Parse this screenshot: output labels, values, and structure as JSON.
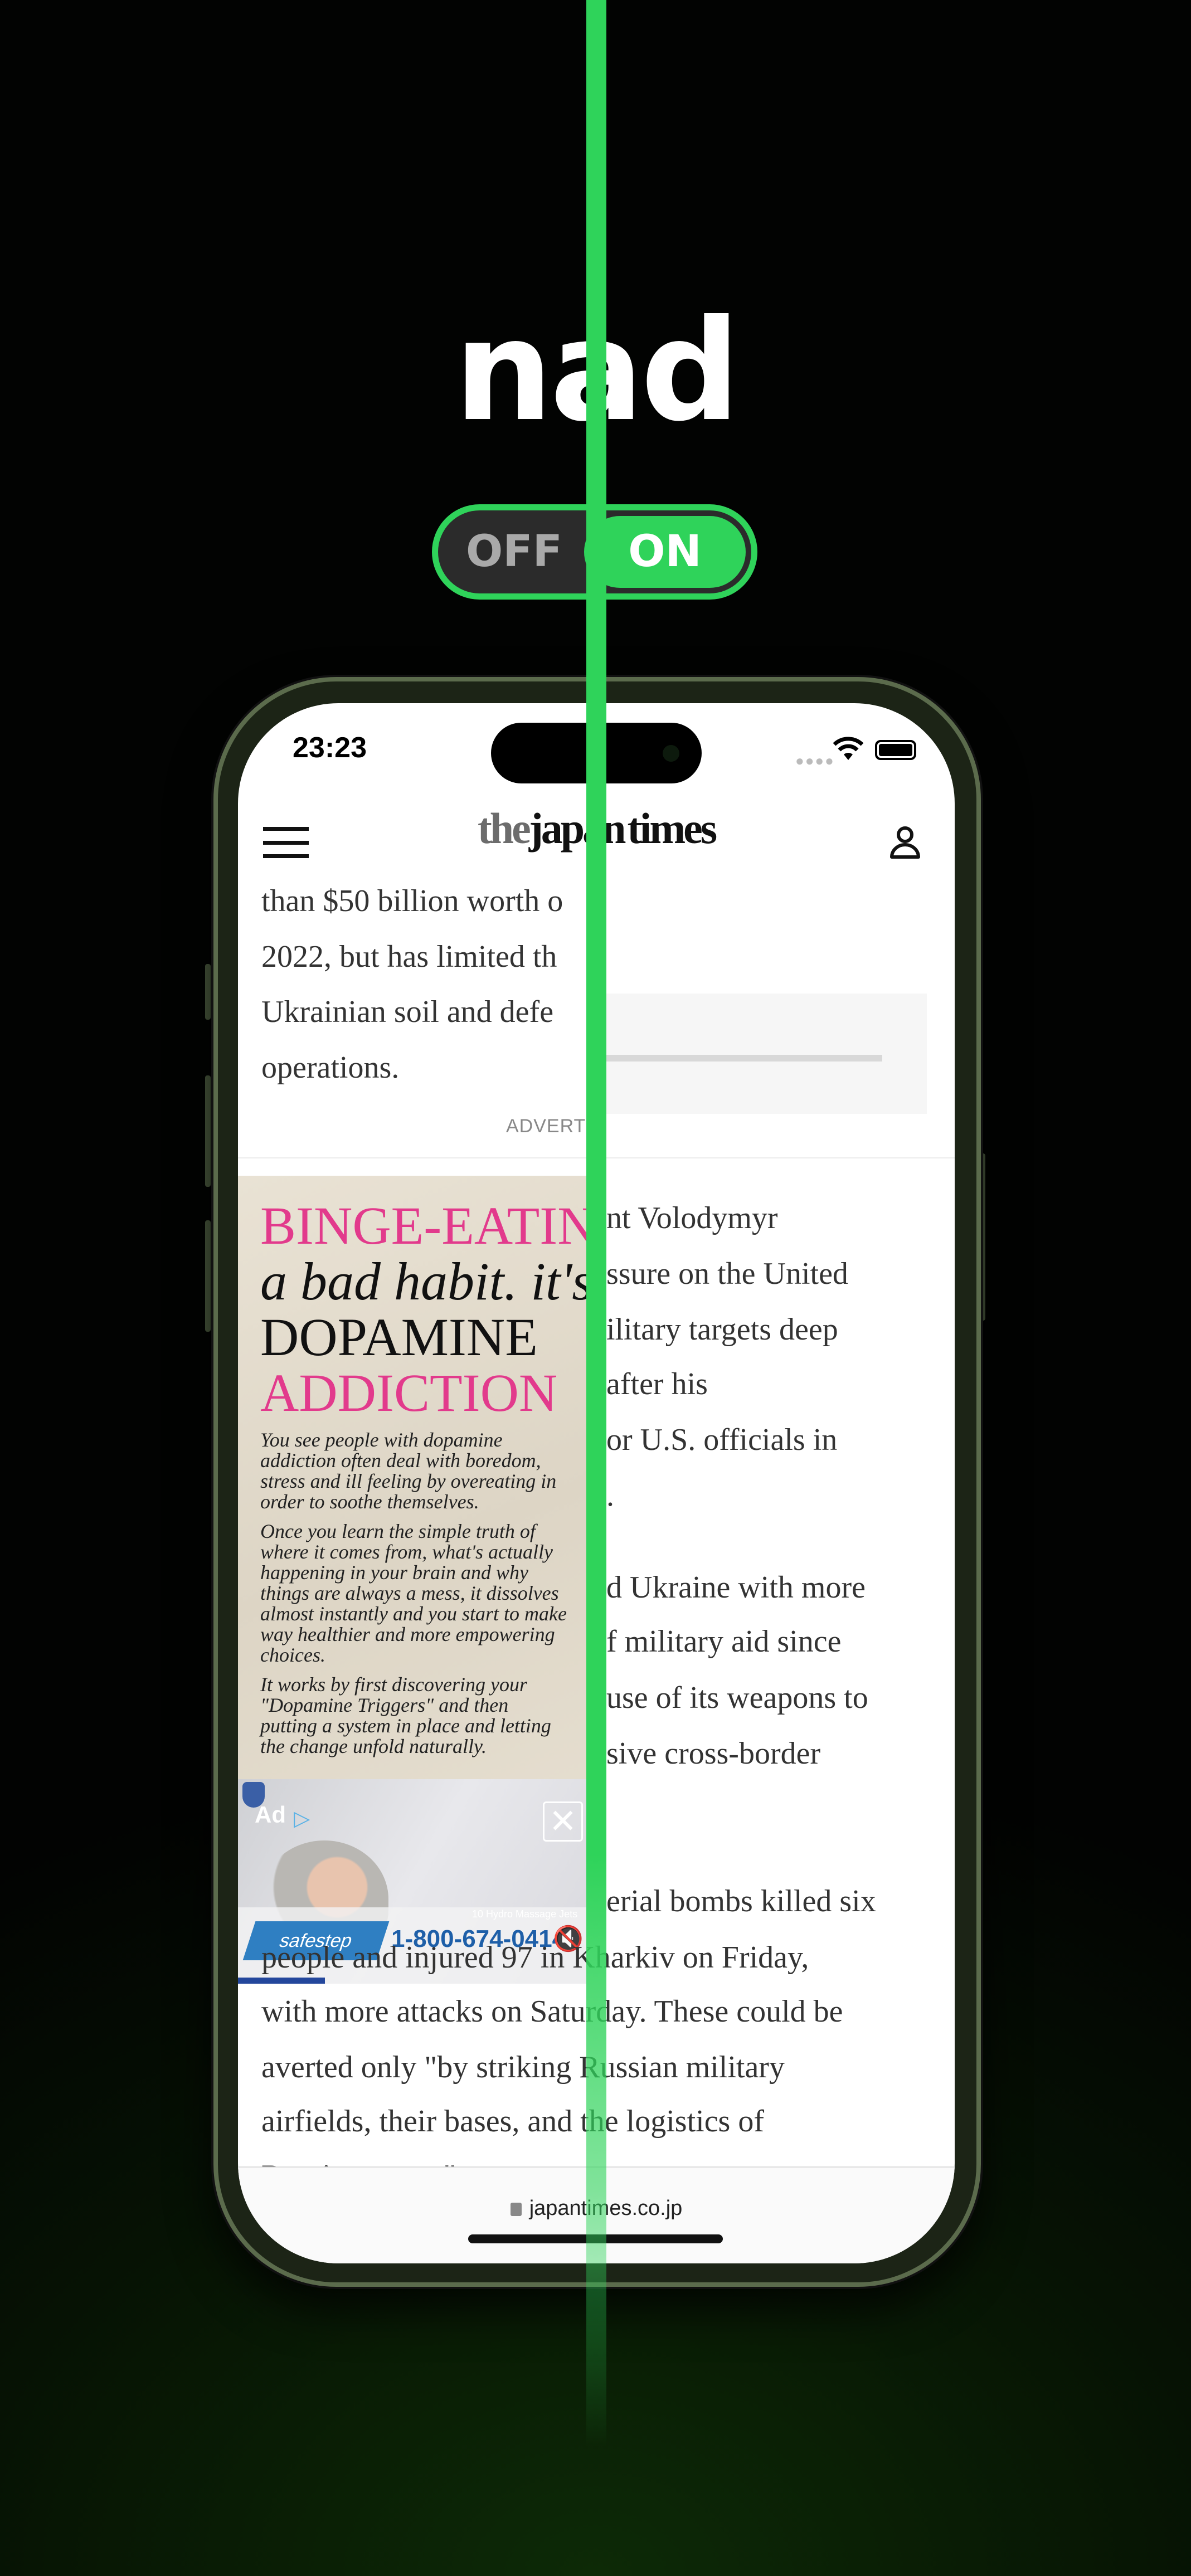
{
  "promo": {
    "title": "nad",
    "toggle_off": "OFF",
    "toggle_on": "ON",
    "accent": "#2fd35a"
  },
  "status": {
    "time": "23:23"
  },
  "header": {
    "logo_the": "the",
    "logo_japan": "japan",
    "logo_times": "times"
  },
  "article": {
    "top_lines": [
      "than $50 billion worth o",
      "2022, but has limited th",
      "Ukrainian soil and defe",
      "operations."
    ],
    "advert_label": "ADVERT",
    "right_lines": [
      "nt Volodymyr",
      "ssure on the United",
      "ilitary targets deep",
      "after his",
      "or U.S. officials in",
      ".",
      "d Ukraine with more",
      "f military aid since",
      "use of its weapons to",
      "sive cross-border",
      "erial bombs killed six"
    ],
    "bottom_lines": [
      "people and injured 97 in Kharkiv on Friday,",
      "with more attacks on Saturday. These could be",
      "averted only \"by striking Russian military",
      "airfields, their bases, and the logistics of",
      "Russian terror.\""
    ]
  },
  "ad": {
    "headline1": "BINGE-EATING",
    "headline2": "a bad habit. it's",
    "headline3": "DOPAMINE ",
    "headline3_accent": "ADDICTION",
    "para1": "You see people with dopamine addiction often deal with boredom, stress and ill feeling by overeating in order to soothe themselves.",
    "para2": "Once you learn the simple truth of where it comes from, what's actually happening in your brain and why things are always a mess, it dissolves almost instantly and you start to make way healthier and more empowering choices.",
    "para3": "It works by first discovering your \"Dopamine Triggers\" and then putting a system in place and letting the change unfold naturally."
  },
  "video_ad": {
    "tag": "Ad",
    "brand": "safestep",
    "phone": "1-800-674-0414",
    "caption": "10 Hydro Massage Jets",
    "close": "✕",
    "progress": 0.25
  },
  "browser": {
    "url": "japantimes.co.jp"
  }
}
